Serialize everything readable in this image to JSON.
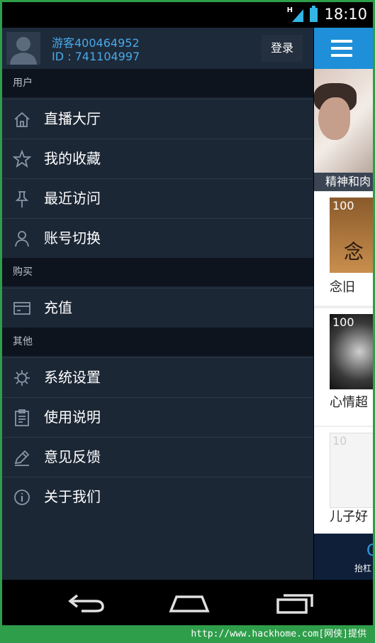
{
  "status_bar": {
    "time": "18:10",
    "network_label": "H"
  },
  "profile": {
    "username": "游客400464952",
    "user_id": "ID : 741104997",
    "login_label": "登录"
  },
  "sections": [
    {
      "header": "用户",
      "items": [
        {
          "label": "直播大厅",
          "icon": "home-icon"
        },
        {
          "label": "我的收藏",
          "icon": "star-icon"
        },
        {
          "label": "最近访问",
          "icon": "pin-icon"
        },
        {
          "label": "账号切换",
          "icon": "user-icon"
        }
      ]
    },
    {
      "header": "购买",
      "items": [
        {
          "label": "充值",
          "icon": "card-icon"
        }
      ]
    },
    {
      "header": "其他",
      "items": [
        {
          "label": "系统设置",
          "icon": "gear-icon"
        },
        {
          "label": "使用说明",
          "icon": "clipboard-icon"
        },
        {
          "label": "意见反馈",
          "icon": "pencil-icon"
        },
        {
          "label": "关于我们",
          "icon": "info-icon"
        }
      ]
    }
  ],
  "content": {
    "banner_caption": "精神和肉",
    "cards": [
      {
        "badge": "100",
        "title": "念旧"
      },
      {
        "badge": "100",
        "title": "心情超"
      },
      {
        "badge": "10",
        "title": "儿子好"
      }
    ],
    "bottom_tab_label": "抬杠",
    "bottom_tab_icon": "Q"
  },
  "navbar": [
    "back-icon",
    "home-nav-icon",
    "recent-apps-icon"
  ],
  "footer": "http://www.hackhome.com[网侠]提供",
  "colors": {
    "drawer_bg": "#1c2735",
    "section_bg": "#0e141d",
    "accent": "#4aa8e8",
    "topbar": "#1e8fd8",
    "frame": "#2f9e4a"
  }
}
